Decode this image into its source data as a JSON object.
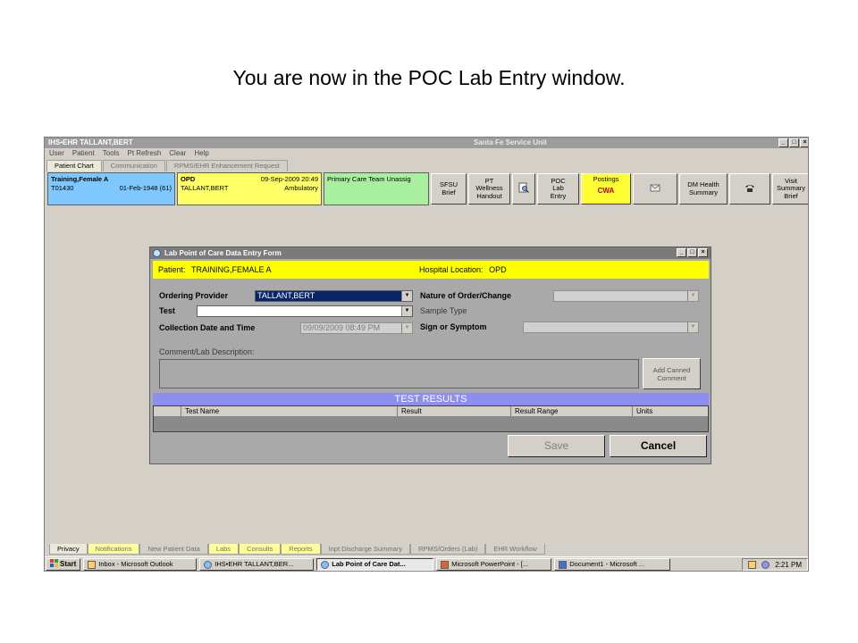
{
  "caption": "You are now in the POC Lab Entry window.",
  "app": {
    "title": "IHS•EHR  TALLANT,BERT",
    "location": "Santa Fe Service Unit",
    "menu": [
      "User",
      "Patient",
      "Tools",
      "Pt Refresh",
      "Clear",
      "Help"
    ],
    "tabs": [
      "Patient Chart",
      "Communication",
      "RPMS/EHR Enhancement Request"
    ],
    "patient": {
      "name": "Training,Female A",
      "id": "T01430",
      "dob": "01-Feb-1948 (61)",
      "visit_type": "OPD",
      "visit_date": "09-Sep-2009 20:49",
      "provider": "TALLANT,BERT",
      "status": "Ambulatory",
      "team": "Primary Care Team Unassig"
    },
    "toolbar": {
      "sfsu": [
        "SFSU",
        "Brief"
      ],
      "pt_wellness": [
        "PT",
        "Wellness",
        "Handout"
      ],
      "poc": [
        "POC",
        "Lab",
        "Entry"
      ],
      "postings": "Postings",
      "cwa": "CWA",
      "dm_health": [
        "DM Health",
        "Summary"
      ],
      "visit_summary": [
        "Visit",
        "Summary",
        "Brief"
      ]
    },
    "bottom_tabs": [
      "Privacy",
      "Notifications",
      "New Patient Data",
      "Labs",
      "Consults",
      "Reports",
      "Inpt Discharge Summary",
      "RPMS/Orders (Lab)",
      "EHR Workflow"
    ]
  },
  "dialog": {
    "title": "Lab Point of Care Data Entry Form",
    "patient_label": "Patient:",
    "patient_value": "TRAINING,FEMALE A",
    "hospital_label": "Hospital Location:",
    "hospital_value": "OPD",
    "ordering_provider_label": "Ordering Provider",
    "ordering_provider_value": "TALLANT,BERT",
    "test_label": "Test",
    "test_value": "",
    "collection_label": "Collection Date and Time",
    "collection_value": "09/09/2009 08:49 PM",
    "nature_label": "Nature of Order/Change",
    "sample_label": "Sample Type",
    "sign_label": "Sign or Symptom",
    "comment_label": "Comment/Lab Description:",
    "add_canned": [
      "Add Canned",
      "Comment"
    ],
    "results_header": "TEST RESULTS",
    "columns": [
      "Test Name",
      "Result",
      "Result Range",
      "Units"
    ],
    "save_label": "Save",
    "cancel_label": "Cancel"
  },
  "taskbar": {
    "start": "Start",
    "tasks": [
      "Inbox - Microsoft Outlook",
      "IHS•EHR  TALLANT,BER...",
      "Lab Point of Care Dat...",
      "Microsoft PowerPoint - [...",
      "Document1 - Microsoft ..."
    ],
    "time": "2:21 PM"
  }
}
